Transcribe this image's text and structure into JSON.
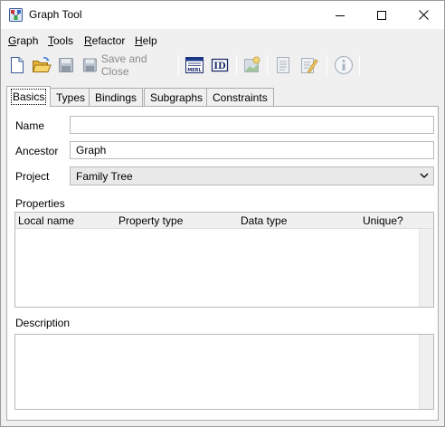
{
  "window": {
    "title": "Graph Tool",
    "controls": {
      "minimize": "minimize",
      "maximize": "maximize",
      "close": "close"
    }
  },
  "menu": {
    "graph": {
      "accel": "G",
      "rest": "raph"
    },
    "tools": {
      "accel": "T",
      "rest": "ools"
    },
    "refactor": {
      "accel": "R",
      "rest": "efactor"
    },
    "help": {
      "accel": "H",
      "rest": "elp"
    }
  },
  "toolbar": {
    "save_and_close_label": "Save and Close",
    "merl_icon_text": "MERL",
    "id_icon_text": "ID",
    "icons": [
      "new-document-icon",
      "open-folder-icon",
      "save-icon",
      "save-and-close-icon",
      "merl-icon",
      "id-icon",
      "image-icon",
      "properties-icon",
      "edit-icon",
      "info-icon"
    ]
  },
  "tabs": [
    "Basics",
    "Types",
    "Bindings",
    "Subgraphs",
    "Constraints"
  ],
  "basics": {
    "name_label": "Name",
    "name_value": "",
    "ancestor_label": "Ancestor",
    "ancestor_value": "Graph",
    "project_label": "Project",
    "project_value": "Family Tree",
    "properties_label": "Properties",
    "properties_columns": [
      "Local name",
      "Property type",
      "Data type",
      "Unique?"
    ],
    "properties_rows": [],
    "description_label": "Description",
    "description_value": ""
  },
  "colors": {
    "window_bg": "#f0f0f0",
    "panel_bg": "#ffffff",
    "border": "#adadad",
    "disabled_text": "#8a8a8a"
  }
}
